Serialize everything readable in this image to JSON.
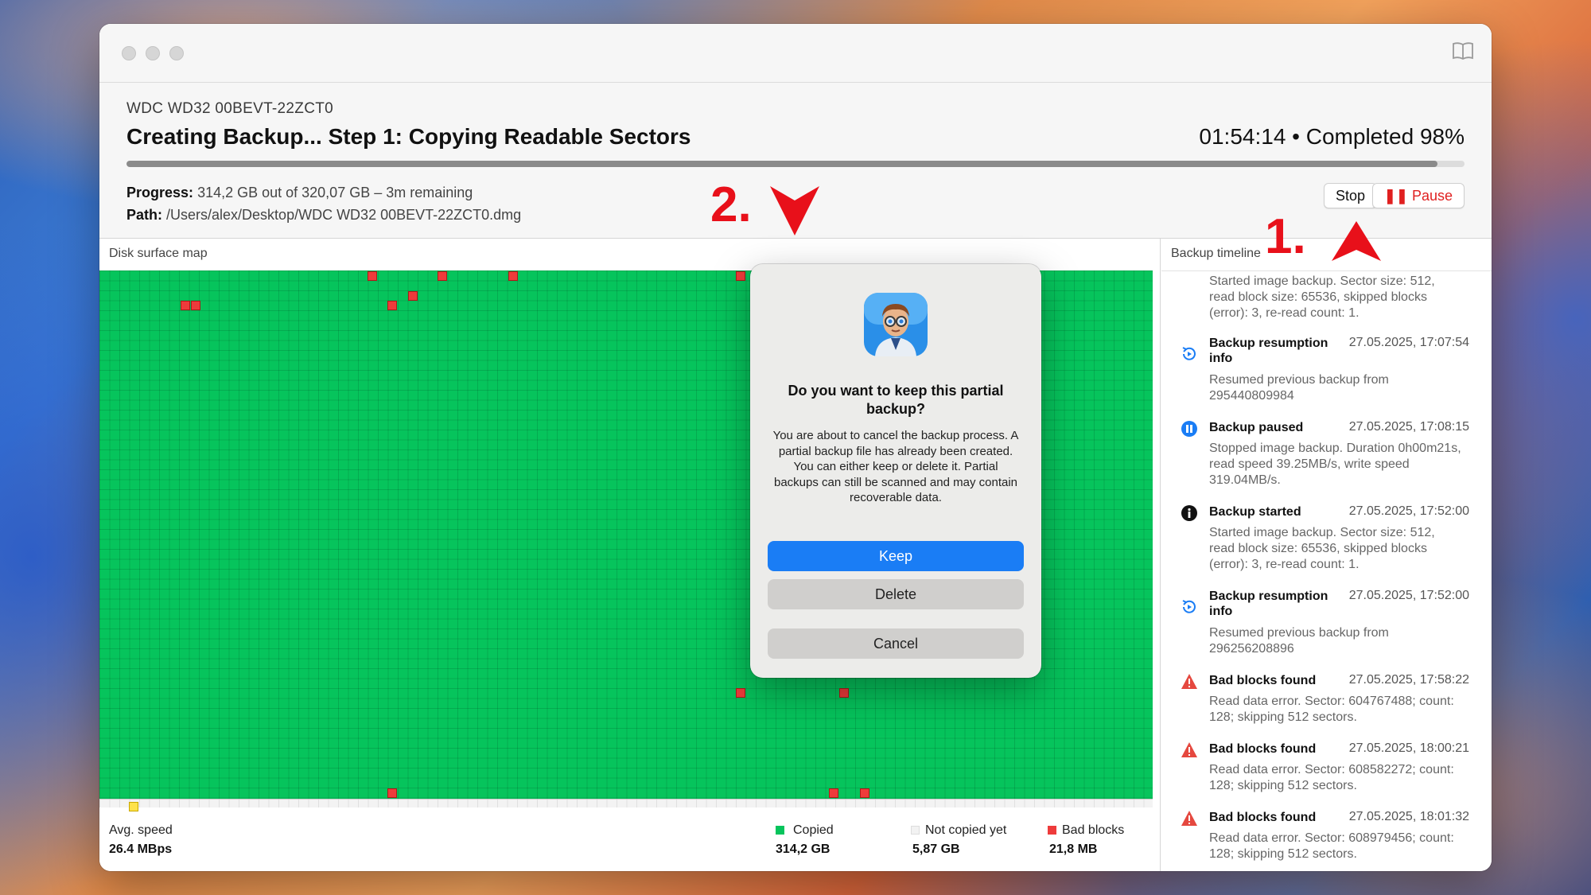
{
  "window": {
    "device_name": "WDC WD32 00BEVT-22ZCT0",
    "status_title": "Creating Backup... Step 1: Copying Readable Sectors",
    "completion": "01:54:14 • Completed 98%",
    "progress_fraction": 0.98,
    "progress_label": "Progress:",
    "progress_text": "314,2 GB out of 320,07 GB – 3m remaining",
    "path_label": "Path:",
    "path_text": "/Users/alex/Desktop/WDC WD32 00BEVT-22ZCT0.dmg",
    "stop_label": "Stop",
    "pause_label": "Pause"
  },
  "map": {
    "panel_title": "Disk surface map",
    "avg_speed_label": "Avg. speed",
    "avg_speed_value": "26.4 MBps",
    "legend": [
      {
        "label": "Copied",
        "value": "314,2 GB",
        "color": "#06c45c"
      },
      {
        "label": "Not copied yet",
        "value": "5,87 GB",
        "color": "#f2f2f2"
      },
      {
        "label": "Bad blocks",
        "value": "21,8 MB",
        "color": "#ee3b3b"
      }
    ]
  },
  "timeline": {
    "panel_title": "Backup timeline",
    "entries": [
      {
        "icon": "none",
        "title": "",
        "time": "",
        "desc": "Started image backup. Sector size: 512, read block size: 65536, skipped blocks (error): 3, re-read count: 1."
      },
      {
        "icon": "resume-icon",
        "title": "Backup resumption info",
        "time": "27.05.2025, 17:07:54",
        "desc": "Resumed previous backup from 295440809984"
      },
      {
        "icon": "pause-icon",
        "title": "Backup paused",
        "time": "27.05.2025, 17:08:15",
        "desc": "Stopped image backup. Duration 0h00m21s, read speed 39.25MB/s, write speed 319.04MB/s."
      },
      {
        "icon": "info-icon",
        "title": "Backup started",
        "time": "27.05.2025, 17:52:00",
        "desc": "Started image backup. Sector size: 512, read block size: 65536, skipped blocks (error): 3, re-read count: 1."
      },
      {
        "icon": "resume-icon",
        "title": "Backup resumption info",
        "time": "27.05.2025, 17:52:00",
        "desc": "Resumed previous backup from 296256208896"
      },
      {
        "icon": "warning-icon",
        "title": "Bad blocks found",
        "time": "27.05.2025, 17:58:22",
        "desc": "Read data error. Sector: 604767488; count: 128; skipping 512 sectors."
      },
      {
        "icon": "warning-icon",
        "title": "Bad blocks found",
        "time": "27.05.2025, 18:00:21",
        "desc": "Read data error. Sector: 608582272; count: 128; skipping 512 sectors."
      },
      {
        "icon": "warning-icon",
        "title": "Bad blocks found",
        "time": "27.05.2025, 18:01:32",
        "desc": "Read data error. Sector: 608979456; count: 128; skipping 512 sectors."
      }
    ]
  },
  "dialog": {
    "title": "Do you want to keep this partial backup?",
    "body": "You are about to cancel the backup process. A partial backup file has already been created. You can either keep or delete it. Partial backups can still be scanned and may contain recoverable data.",
    "keep_label": "Keep",
    "delete_label": "Delete",
    "cancel_label": "Cancel"
  },
  "annotations": {
    "step1": "1.",
    "step2": "2."
  },
  "colors": {
    "accent_blue": "#1a7df5",
    "pause_red": "#e02020",
    "copied_green": "#06c45c",
    "annotation_red": "#e8101a"
  }
}
